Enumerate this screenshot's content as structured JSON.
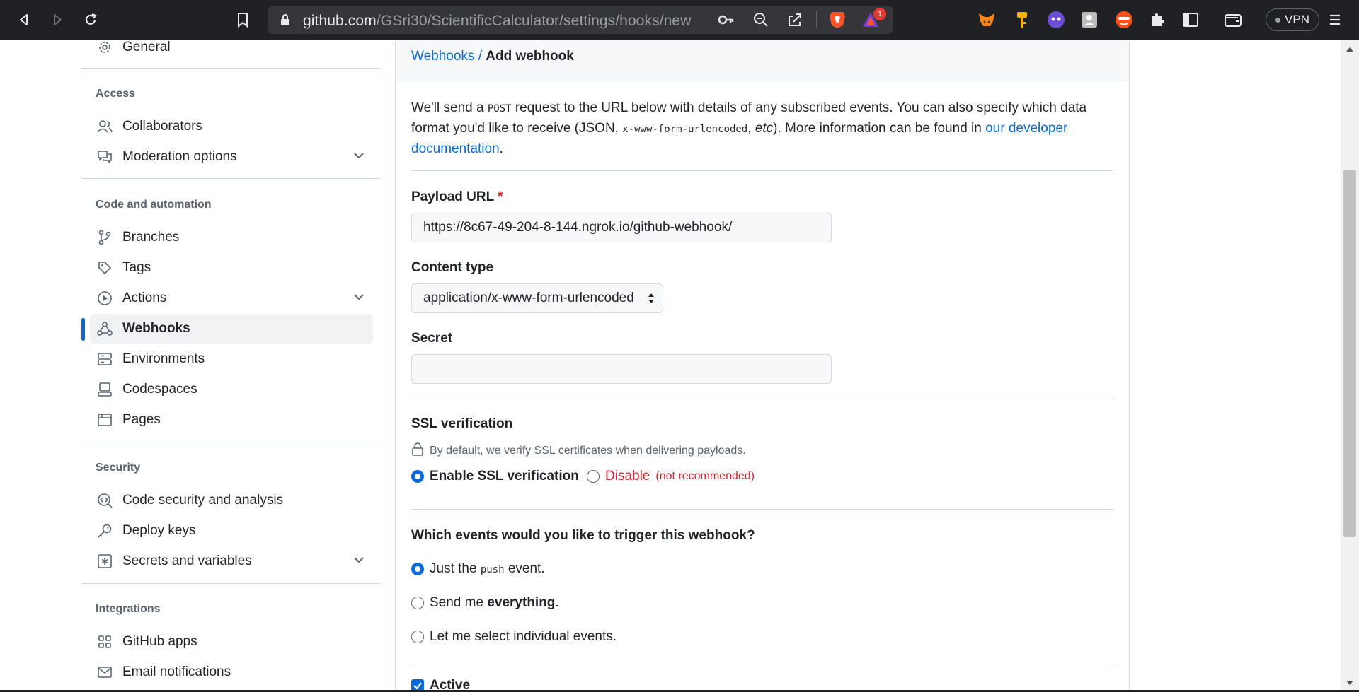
{
  "browser": {
    "url_host": "github.com",
    "url_path": "/GSri30/ScientificCalculator/settings/hooks/new",
    "notification_badge": "1",
    "vpn_label": "VPN"
  },
  "sidebar": {
    "general": "General",
    "sections": {
      "access": "Access",
      "code": "Code and automation",
      "security": "Security",
      "integrations": "Integrations"
    },
    "items": {
      "collaborators": "Collaborators",
      "moderation": "Moderation options",
      "branches": "Branches",
      "tags": "Tags",
      "actions": "Actions",
      "webhooks": "Webhooks",
      "environments": "Environments",
      "codespaces": "Codespaces",
      "pages": "Pages",
      "code_security": "Code security and analysis",
      "deploy_keys": "Deploy keys",
      "secrets": "Secrets and variables",
      "github_apps": "GitHub apps",
      "email": "Email notifications"
    }
  },
  "main": {
    "breadcrumb_link": "Webhooks",
    "breadcrumb_sep": " / ",
    "breadcrumb_current": "Add webhook",
    "intro": {
      "p1": "We'll send a ",
      "post": "POST",
      "p2": " request to the URL below with details of any subscribed events. You can also specify which data format you'd like to receive (JSON, ",
      "urlencoded": "x-www-form-urlencoded",
      "p3": ", ",
      "etc": "etc",
      "p4": "). More information can be found in ",
      "link": "our developer documentation",
      "p5": "."
    },
    "payload_label": "Payload URL",
    "payload_required": "*",
    "payload_value": "https://8c67-49-204-8-144.ngrok.io/github-webhook/",
    "content_type_label": "Content type",
    "content_type_value": "application/x-www-form-urlencoded",
    "secret_label": "Secret",
    "secret_value": "",
    "ssl_label": "SSL verification",
    "ssl_note": "By default, we verify SSL certificates when delivering payloads.",
    "ssl_enable": "Enable SSL verification",
    "ssl_disable": "Disable",
    "ssl_not_recommended": "(not recommended)",
    "events_label": "Which events would you like to trigger this webhook?",
    "event_push_1": "Just the ",
    "event_push_code": "push",
    "event_push_2": " event.",
    "event_all_1": "Send me ",
    "event_all_2": "everything",
    "event_all_3": ".",
    "event_select": "Let me select individual events.",
    "active_label": "Active"
  }
}
